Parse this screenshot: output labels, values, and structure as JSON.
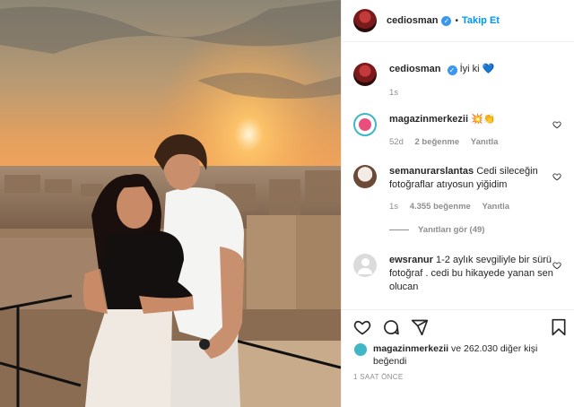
{
  "post": {
    "author": "cediosman",
    "follow_label": "Takip Et",
    "separator": "•",
    "caption": {
      "username": "cediosman",
      "text": "İyi ki",
      "emoji": "💙",
      "age": "1s"
    },
    "comments": [
      {
        "username": "magazinmerkezii",
        "text": "💥👏",
        "age": "52d",
        "likes": "2 beğenme",
        "reply": "Yanıtla"
      },
      {
        "username": "semanurarslantas",
        "text": "Cedi sileceğin fotoğraflar atıyosun yiğidim",
        "age": "1s",
        "likes": "4.355 beğenme",
        "reply": "Yanıtla",
        "view_replies": "Yanıtları gör (49)"
      },
      {
        "username": "ewsranur",
        "text": "1-2 aylık sevgiliyle bir sürü fotoğraf . cedi bu hikayede yanan sen olucan",
        "age": "",
        "likes": "",
        "reply": ""
      }
    ],
    "liked_by": {
      "user": "magazinmerkezii",
      "rest": "ve 262.030 diğer kişi beğendi"
    },
    "time": "1 SAAT ÖNCE"
  },
  "colors": {
    "link": "#0095f6",
    "verified": "#3897f0",
    "muted": "#8e8e8e",
    "text": "#262626"
  },
  "icons": [
    "verified-badge-icon",
    "heart-icon",
    "comment-icon",
    "share-icon",
    "bookmark-icon",
    "small-heart-icon"
  ]
}
